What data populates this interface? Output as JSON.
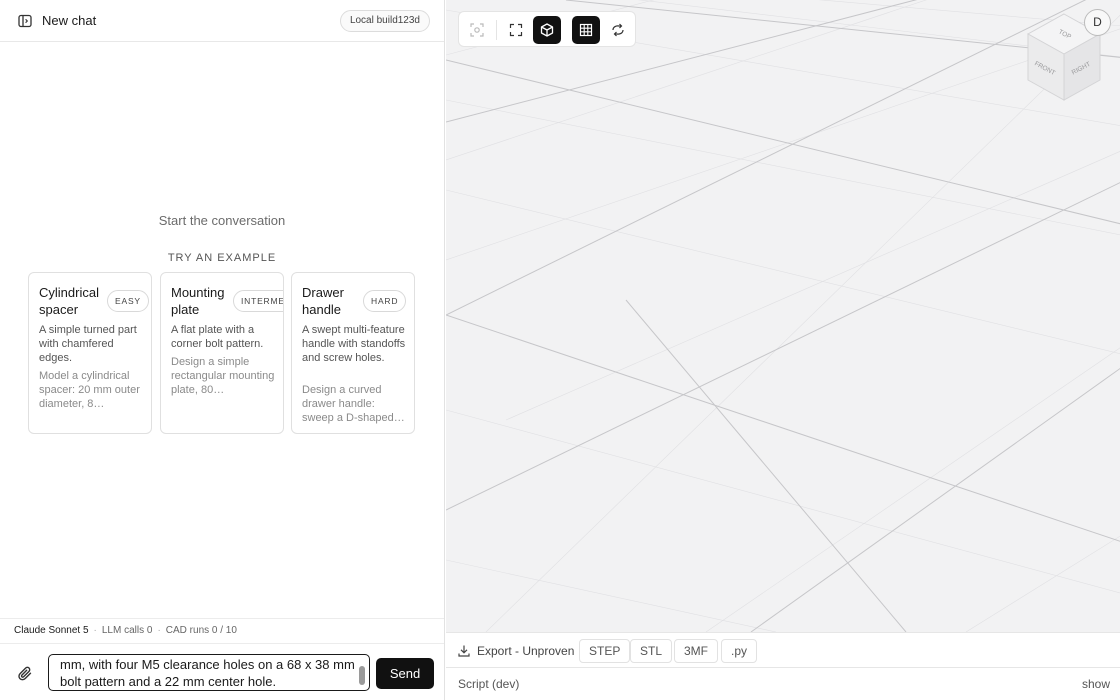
{
  "header": {
    "title": "New chat",
    "badge": "Local build123d"
  },
  "conversation": {
    "empty_text": "Start the conversation",
    "examples_heading": "TRY AN EXAMPLE",
    "examples": [
      {
        "name": "Cylindrical spacer",
        "level": "EASY",
        "desc": "A simple turned part with chamfered edges.",
        "prompt": "Model a cylindrical spacer: 20 mm outer diameter, 8…"
      },
      {
        "name": "Mounting plate",
        "level": "INTERMEDIATE",
        "desc": "A flat plate with a corner bolt pattern.",
        "prompt": "Design a simple rectangular mounting plate, 80…"
      },
      {
        "name": "Drawer handle",
        "level": "HARD",
        "desc": "A swept multi-feature handle with standoffs and screw holes.",
        "prompt": "Design a curved drawer handle: sweep a D-shaped…"
      }
    ]
  },
  "status": {
    "model": "Claude Sonnet 5",
    "llm_calls": "LLM calls 0",
    "cad_runs": "CAD runs 0 / 10",
    "separator": "·"
  },
  "composer": {
    "input_text": "mm, with four M5 clearance holes on a 68 x 38 mm bolt pattern and a 22 mm center hole.",
    "send_label": "Send"
  },
  "viewer": {
    "avatar": "D",
    "toolbar": [
      "focus",
      "fullscreen",
      "3d-view",
      "grid",
      "orbit"
    ],
    "active_tools": [
      "3d-view",
      "grid"
    ],
    "view_cube_faces": [
      "TOP",
      "FRONT",
      "RIGHT"
    ]
  },
  "export": {
    "label": "Export - Unproven",
    "formats": [
      "STEP",
      "STL",
      "3MF",
      ".py"
    ]
  },
  "script": {
    "label": "Script (dev)",
    "toggle": "show"
  }
}
